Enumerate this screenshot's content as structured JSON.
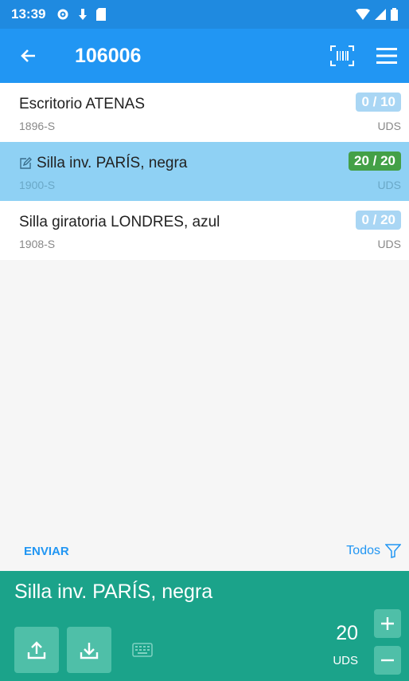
{
  "status_bar": {
    "time": "13:39"
  },
  "app_bar": {
    "title": "106006"
  },
  "items": [
    {
      "name": "Escritorio ATENAS",
      "code": "1896-S",
      "progress": "0 / 10",
      "unit": "UDS"
    },
    {
      "name": "Silla inv. PARÍS, negra",
      "code": "1900-S",
      "progress": "20 / 20",
      "unit": "UDS"
    },
    {
      "name": "Silla giratoria LONDRES, azul",
      "code": "1908-S",
      "progress": "0 / 20",
      "unit": "UDS"
    }
  ],
  "footer": {
    "send_label": "ENVIAR",
    "filter_label": "Todos"
  },
  "bottom_panel": {
    "selected_name": "Silla inv. PARÍS, negra",
    "quantity": "20",
    "unit": "UDS"
  },
  "colors": {
    "status_bar": "#1f8ae0",
    "app_bar": "#2196f3",
    "selected_row": "#8fd1f4",
    "done_badge": "#43a047",
    "pending_badge": "#a9d6f4",
    "bottom_panel": "#1ba38a"
  }
}
